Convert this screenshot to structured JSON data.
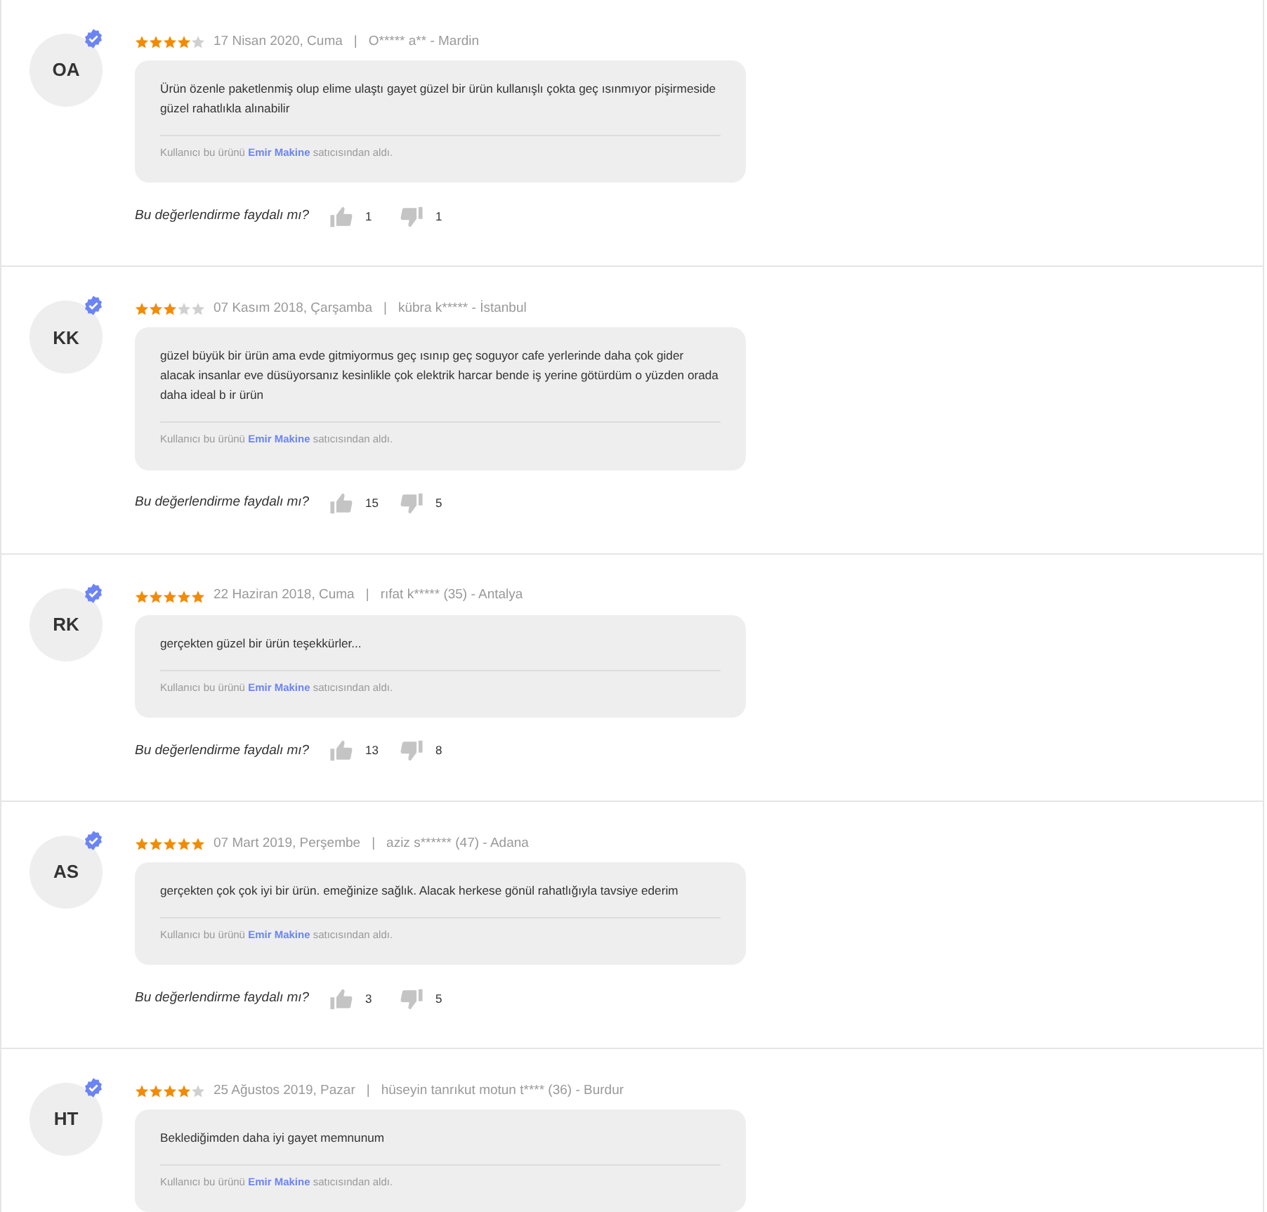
{
  "reviews": [
    {
      "initials": "OA",
      "verified": true,
      "stars": 4,
      "date": "17 Nisan 2020, Cuma",
      "separator": "|",
      "user": "O***** a** - Mardin",
      "text": "Ürün özenle paketlenmiş olup elime ulaştı gayet güzel bir ürün kullanışlı çokta geç ısınmıyor pişirmeside güzel rahatlıkla alınabilir",
      "seller_prefix": "Kullanıcı bu ürünü",
      "seller": "Emir Makine",
      "seller_suffix": "satıcısından aldı.",
      "helpful_question": "Bu değerlendirme faydalı mı?",
      "likes": "1",
      "dislikes": "1"
    },
    {
      "initials": "KK",
      "verified": true,
      "stars": 3,
      "date": "07 Kasım 2018, Çarşamba",
      "separator": "|",
      "user": "kübra k***** - İstanbul",
      "text": "güzel büyük bir ürün ama evde gitmiyormus geç ısınıp geç soguyor cafe yerlerinde daha çok gider alacak insanlar eve düsüyorsanız kesinlikle çok elektrik harcar bende iş yerine götürdüm o yüzden orada daha ideal b ir ürün",
      "seller_prefix": "Kullanıcı bu ürünü",
      "seller": "Emir Makine",
      "seller_suffix": "satıcısından aldı.",
      "helpful_question": "Bu değerlendirme faydalı mı?",
      "likes": "15",
      "dislikes": "5"
    },
    {
      "initials": "RK",
      "verified": true,
      "stars": 5,
      "date": "22 Haziran 2018, Cuma",
      "separator": "|",
      "user": "rıfat k***** (35) - Antalya",
      "text": "gerçekten güzel bir ürün teşekkürler...",
      "seller_prefix": "Kullanıcı bu ürünü",
      "seller": "Emir Makine",
      "seller_suffix": "satıcısından aldı.",
      "helpful_question": "Bu değerlendirme faydalı mı?",
      "likes": "13",
      "dislikes": "8"
    },
    {
      "initials": "AS",
      "verified": true,
      "stars": 5,
      "date": "07 Mart 2019, Perşembe",
      "separator": "|",
      "user": "aziz s****** (47) - Adana",
      "text": "gerçekten çok çok iyi bir ürün. emeğinize sağlık. Alacak herkese gönül rahatlığıyla tavsiye ederim",
      "seller_prefix": "Kullanıcı bu ürünü",
      "seller": "Emir Makine",
      "seller_suffix": "satıcısından aldı.",
      "helpful_question": "Bu değerlendirme faydalı mı?",
      "likes": "3",
      "dislikes": "5"
    },
    {
      "initials": "HT",
      "verified": true,
      "stars": 4,
      "date": "25 Ağustos 2019, Pazar",
      "separator": "|",
      "user": "hüseyin tanrıkut motun t**** (36) - Burdur",
      "text": "Beklediğimden daha iyi gayet memnunum",
      "seller_prefix": "Kullanıcı bu ürünü",
      "seller": "Emir Makine",
      "seller_suffix": "satıcısından aldı."
    }
  ]
}
